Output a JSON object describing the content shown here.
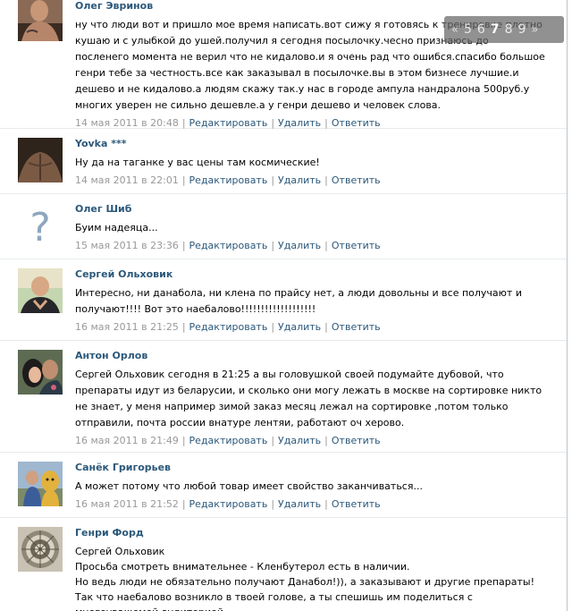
{
  "pager": {
    "prev": "«",
    "pages": [
      "5",
      "6",
      "7",
      "8",
      "9"
    ],
    "current": "7",
    "next": "»"
  },
  "actions": {
    "edit": "Редактировать",
    "delete": "Удалить",
    "reply": "Ответить"
  },
  "comments": [
    {
      "author": "Олег Эвринов",
      "text": "ну что люди вот и пришло мое время написать.вот сижу я готовясь к тренировке плотно кушаю и с улыбкой до ушей.получил я сегодня посылочку.чесно признаюсь до посленего момента не верил что не кидалово.и я очень рад что ошибся.спасибо большое генри тебе за честность.все как заказывал в посылочке.вы в этом бизнесе лучшие.и дешево и не кидалово.а людям скажу так.у нас в городе ампула нандралона 500руб.у многих уверен не сильно дешевле.а у генри дешево и человек слова.",
      "date": "14 мая 2011 в 20:48"
    },
    {
      "author": "Yovka ***",
      "text": "Ну да на таганке у вас цены там космические!",
      "date": "14 мая 2011 в 22:01"
    },
    {
      "author": "Олег Шиб",
      "text": "Буим надеяца...",
      "date": "15 мая 2011 в 23:36"
    },
    {
      "author": "Сергей Ольховик",
      "text": "Интересно, ни данабола, ни клена по прайсу нет, а люди довольны и все получают и получают!!!! Вот это наебалово!!!!!!!!!!!!!!!!!!!",
      "date": "16 мая 2011 в 21:25"
    },
    {
      "author": "Антон Орлов",
      "text": "Сергей Ольховик сегодня в 21:25 а вы головушкой своей подумайте дубовой, что препараты идут из беларусии, и сколько они могу лежать в москве на сортировке никто не знает, у меня например зимой заказ месяц лежал на сортировке ,потом только отправили, почта россии внатуре лентяи, работают оч херово.",
      "date": "16 мая 2011 в 21:49"
    },
    {
      "author": "Санёк Григорьев",
      "text": "А может потому что любой товар имеет свойство заканчиваться...",
      "date": "16 мая 2011 в 21:52"
    },
    {
      "author": "Генри Форд",
      "text": "Сергей Ольховик\nПросьба смотреть внимательнее - Кленбутерол есть в наличии.\nНо ведь люди не обязательно получают Данабол!)), а заказывают и другие препараты!\nТак что наебалово возникло в твоей голове, а ты спешишь им поделиться с многоуважемой аудиторией.",
      "date": ""
    }
  ]
}
